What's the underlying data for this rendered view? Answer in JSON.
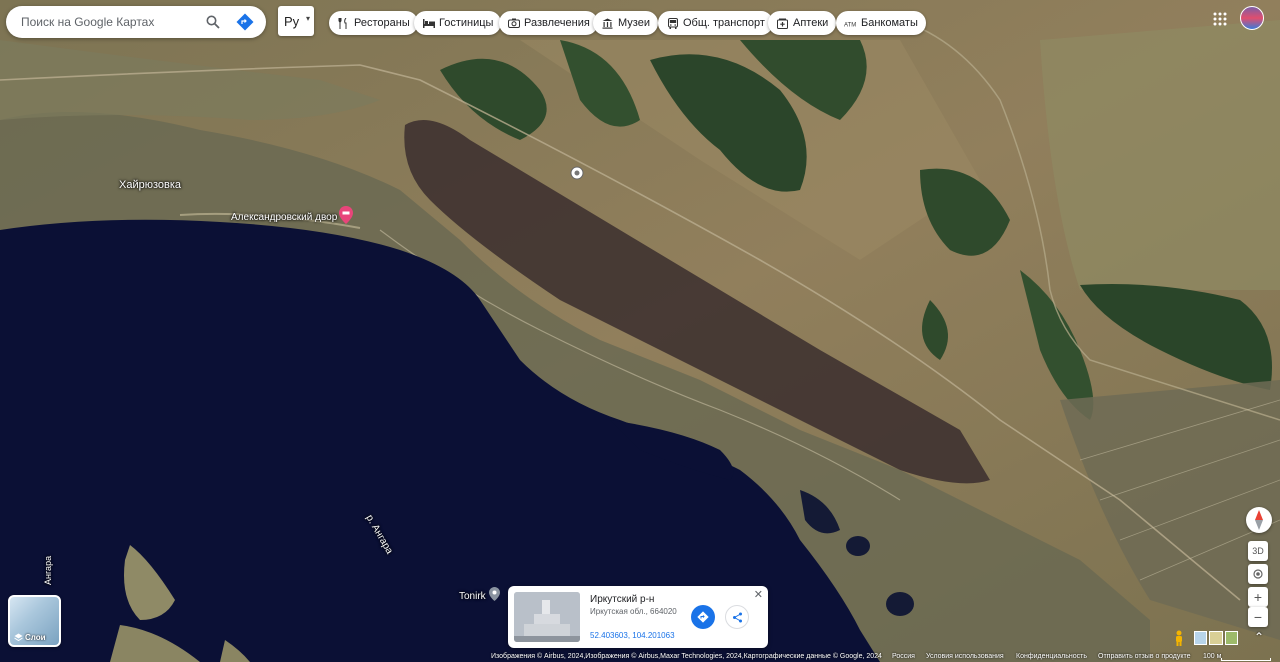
{
  "search": {
    "placeholder": "Поиск на Google Картах"
  },
  "language": {
    "selected": "Ру"
  },
  "categories": [
    {
      "label": "Рестораны",
      "icon": "fork-knife-icon"
    },
    {
      "label": "Гостиницы",
      "icon": "bed-icon"
    },
    {
      "label": "Развлечения",
      "icon": "camera-icon"
    },
    {
      "label": "Музеи",
      "icon": "museum-icon"
    },
    {
      "label": "Общ. транспорт",
      "icon": "bus-icon"
    },
    {
      "label": "Аптеки",
      "icon": "pharmacy-icon"
    },
    {
      "label": "Банкоматы",
      "icon": "atm-icon"
    }
  ],
  "map_labels": {
    "village": "Хайрюзовка",
    "place": "Александровский двор",
    "river": "р. Ангара",
    "river_left": "Ангара",
    "poi": "Tonirk"
  },
  "layers": {
    "label": "Слои"
  },
  "place_card": {
    "title": "Иркутский р-н",
    "address": "Иркутская обл., 664020",
    "coordinates": "52.403603, 104.201063"
  },
  "controls": {
    "tilt_label": "3D"
  },
  "footer": {
    "imagery": "Изображения © Airbus, 2024,Изображения © Airbus,Maxar Technologies, 2024,Картографические данные © Google, 2024",
    "country": "Россия",
    "terms": "Условия использования",
    "privacy": "Конфиденциальность",
    "feedback": "Отправить отзыв о продукте",
    "scale": "100 м"
  },
  "colors": {
    "water": "#0b1035",
    "land": "#8a7d58",
    "forest": "#2f4a2c",
    "accent": "#1a73e8",
    "pin": "#e8457a"
  }
}
